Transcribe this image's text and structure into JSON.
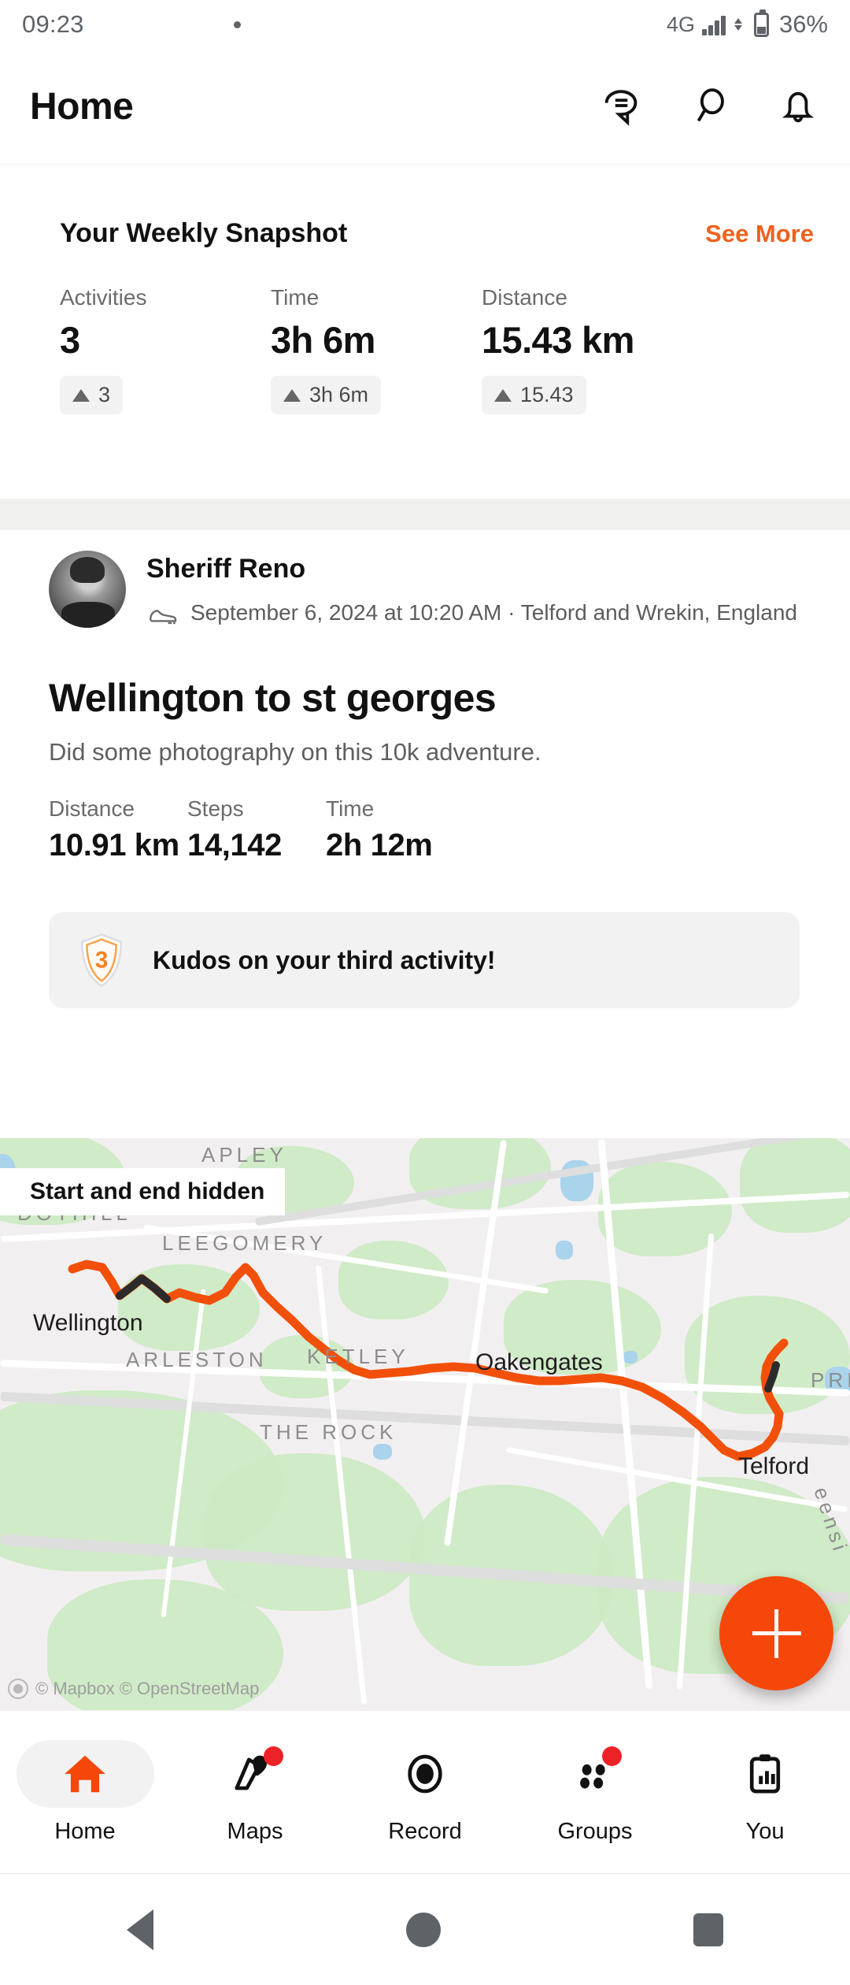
{
  "status_bar": {
    "time": "09:23",
    "icons": [
      "chat-bubble-icon",
      "facebook-icon",
      "messenger-icon",
      "messenger-icon",
      "dot-icon"
    ],
    "network": "4G",
    "battery_percent": "36%"
  },
  "app_bar": {
    "title": "Home",
    "actions": [
      {
        "name": "messages-icon",
        "label": "Messages"
      },
      {
        "name": "search-icon",
        "label": "Search"
      },
      {
        "name": "notifications-bell-icon",
        "label": "Notifications"
      }
    ]
  },
  "weekly_snapshot": {
    "title": "Your Weekly Snapshot",
    "see_more": "See More",
    "stats": [
      {
        "label": "Activities",
        "value": "3",
        "delta": "3"
      },
      {
        "label": "Time",
        "value": "3h 6m",
        "delta": "3h 6m"
      },
      {
        "label": "Distance",
        "value": "15.43 km",
        "delta": "15.43"
      }
    ]
  },
  "activity": {
    "user_name": "Sheriff Reno",
    "activity_type_icon": "shoe-icon",
    "meta": "September 6, 2024 at 10:20 AM · Telford and Wrekin, England",
    "title": "Wellington to st georges",
    "description": "Did some photography on this 10k adventure.",
    "stats": [
      {
        "label": "Distance",
        "value": "10.91 km"
      },
      {
        "label": "Steps",
        "value": "14,142"
      },
      {
        "label": "Time",
        "value": "2h 12m"
      }
    ],
    "kudos": {
      "badge_number": "3",
      "text": "Kudos on your third activity!"
    },
    "map": {
      "privacy_label": "Start and end hidden",
      "attribution": "© Mapbox © OpenStreetMap",
      "route_color": "#f2500a",
      "labels": [
        {
          "text": "APLEY",
          "type": "area"
        },
        {
          "text": "DOTHILL",
          "type": "area"
        },
        {
          "text": "LEEGOMERY",
          "type": "area"
        },
        {
          "text": "Wellington",
          "type": "town"
        },
        {
          "text": "ARLESTON",
          "type": "area"
        },
        {
          "text": "KETLEY",
          "type": "area"
        },
        {
          "text": "Oakengates",
          "type": "town"
        },
        {
          "text": "PRI",
          "type": "area"
        },
        {
          "text": "THE ROCK",
          "type": "area"
        },
        {
          "text": "Telford",
          "type": "town"
        },
        {
          "text": "eensi",
          "type": "area"
        }
      ]
    }
  },
  "fab": {
    "name": "add-activity-button",
    "icon": "plus-icon"
  },
  "bottom_nav": {
    "items": [
      {
        "label": "Home",
        "icon": "home-icon",
        "active": true,
        "badge": false
      },
      {
        "label": "Maps",
        "icon": "map-route-icon",
        "active": false,
        "badge": true
      },
      {
        "label": "Record",
        "icon": "record-icon",
        "active": false,
        "badge": false
      },
      {
        "label": "Groups",
        "icon": "groups-icon",
        "active": false,
        "badge": true
      },
      {
        "label": "You",
        "icon": "clipboard-chart-icon",
        "active": false,
        "badge": false
      }
    ]
  },
  "android_nav": {
    "back": "back-button",
    "home": "home-button",
    "recents": "recents-button"
  },
  "colors": {
    "accent": "#f1601d",
    "fab": "#f5470a",
    "badge": "#ec2227"
  }
}
